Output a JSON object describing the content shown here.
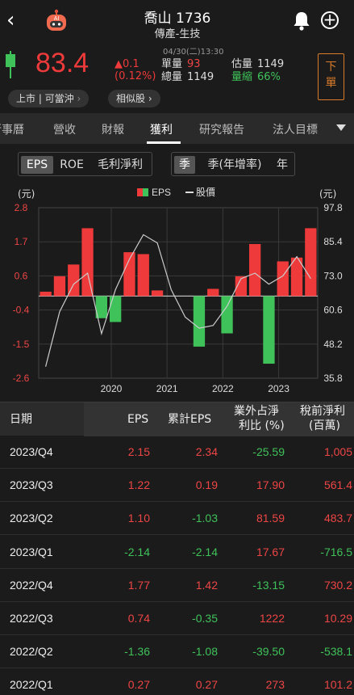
{
  "header": {
    "back_icon": "back-arrow-icon",
    "title": "喬山 1736",
    "subtitle": "傳產-生技"
  },
  "quote": {
    "datetime": "04/30(二)13:30",
    "price": "83.4",
    "change": "▲0.1",
    "change_pct": "(0.12%)",
    "single_label": "單量",
    "single_value": "93",
    "total_label": "總量",
    "total_value": "1149",
    "est_label": "估量",
    "est_value": "1149",
    "shrink_label": "量縮",
    "shrink_value": "66%",
    "order_btn": "下單",
    "listing": "上市 | 可當沖",
    "similar": "相似股"
  },
  "tabs": [
    "行事曆",
    "營收",
    "財報",
    "獲利",
    "研究報告",
    "法人目標"
  ],
  "active_tab": "獲利",
  "seg1": [
    "EPS",
    "ROE",
    "毛利淨利"
  ],
  "seg2": [
    "季",
    "季(年增率)",
    "年"
  ],
  "colors": {
    "up": "#ee3a3a",
    "down": "#3fc25a",
    "accent": "#d97b2a"
  },
  "chart_data": {
    "type": "bar",
    "legend": {
      "eps": "EPS",
      "price": "股價"
    },
    "left_unit": "(元)",
    "right_unit": "(元)",
    "left_ticks": [
      "2.8",
      "1.7",
      "0.6",
      "-0.4",
      "-1.5",
      "-2.6"
    ],
    "right_ticks": [
      "97.8",
      "85.4",
      "73.0",
      "60.6",
      "48.2",
      "35.8"
    ],
    "left_range": [
      -2.6,
      2.8
    ],
    "right_range": [
      35.8,
      97.8
    ],
    "x_labels": [
      "2020",
      "2021",
      "2022",
      "2023"
    ],
    "eps": [
      0.14,
      0.63,
      1.0,
      2.15,
      -0.7,
      -0.82,
      1.39,
      1.33,
      0.18,
      0,
      0,
      -1.6,
      0.23,
      -1.18,
      0.63,
      1.65,
      -2.14,
      1.1,
      1.22,
      2.15
    ],
    "price": [
      40,
      60,
      70,
      74,
      52,
      68,
      79,
      88,
      85,
      68,
      58,
      54,
      55,
      62,
      72,
      74,
      70,
      73,
      80,
      72
    ]
  },
  "table": {
    "headers": {
      "date": "日期",
      "eps": "EPS",
      "cum": "累計EPS",
      "nonop1": "業外占淨",
      "nonop2": "利比 (%)",
      "pretax1": "稅前淨利",
      "pretax2": "(百萬)"
    },
    "rows": [
      {
        "date": "2023/Q4",
        "eps": "2.15",
        "cum": "2.34",
        "nonop": "-25.59",
        "pretax": "1,005"
      },
      {
        "date": "2023/Q3",
        "eps": "1.22",
        "cum": "0.19",
        "nonop": "17.90",
        "pretax": "561.4"
      },
      {
        "date": "2023/Q2",
        "eps": "1.10",
        "cum": "-1.03",
        "nonop": "81.59",
        "pretax": "483.7"
      },
      {
        "date": "2023/Q1",
        "eps": "-2.14",
        "cum": "-2.14",
        "nonop": "17.67",
        "pretax": "-716.5"
      },
      {
        "date": "2022/Q4",
        "eps": "1.77",
        "cum": "1.42",
        "nonop": "-13.15",
        "pretax": "730.2"
      },
      {
        "date": "2022/Q3",
        "eps": "0.74",
        "cum": "-0.35",
        "nonop": "1222",
        "pretax": "10.29"
      },
      {
        "date": "2022/Q2",
        "eps": "-1.36",
        "cum": "-1.08",
        "nonop": "-39.50",
        "pretax": "-538.1"
      },
      {
        "date": "2022/Q1",
        "eps": "0.27",
        "cum": "0.27",
        "nonop": "273",
        "pretax": "101.2"
      }
    ]
  }
}
